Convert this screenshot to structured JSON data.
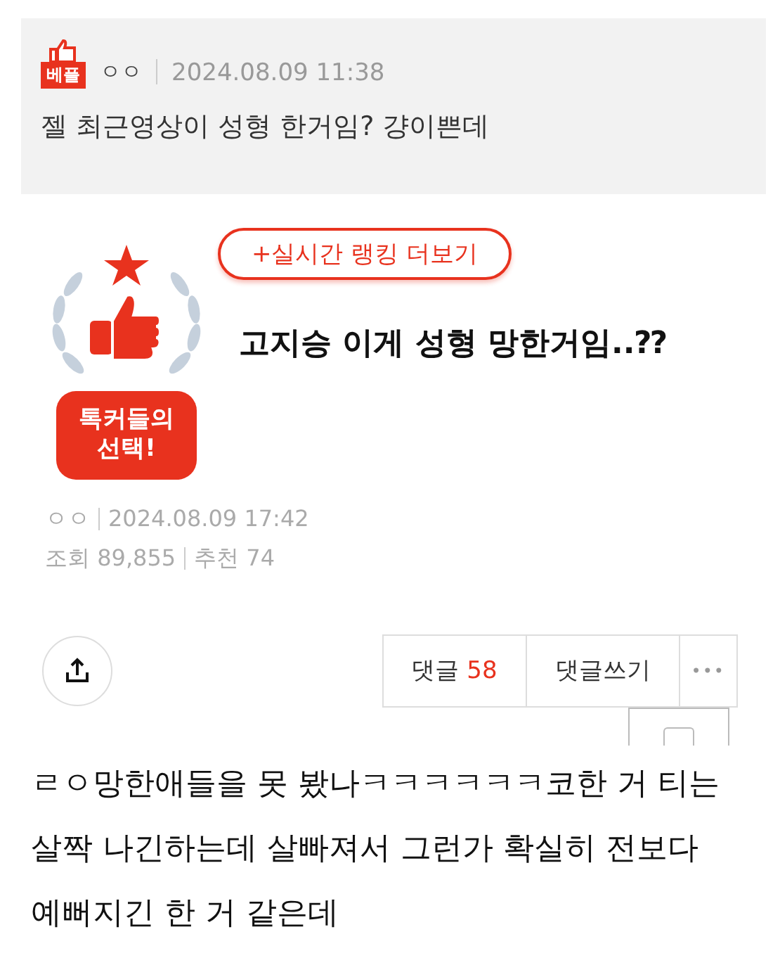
{
  "best_comment": {
    "badge": "베플",
    "author": "ㅇㅇ",
    "date": "2024.08.09 11:38",
    "text": "젤 최근영상이 성형 한거임? 걍이쁜데"
  },
  "ranking_button": "+실시간 랭킹 더보기",
  "emblem": {
    "label": "톡커들의\n선택!"
  },
  "post": {
    "title": "고지승 이게 성형 망한거임..⁇",
    "author": "ㅇㅇ",
    "date": "2024.08.09 17:42",
    "views_label": "조회",
    "views": "89,855",
    "likes_label": "추천",
    "likes": "74"
  },
  "actions": {
    "comments_label": "댓글",
    "comments_count": "58",
    "write_label": "댓글쓰기",
    "more": "•••"
  },
  "body": "ㄹㅇ망한애들을 못 봤나ㅋㅋㅋㅋㅋㅋ코한 거 티는 살짝 나긴하는데 살빠져서 그런가 확실히 전보다 예뻐지긴 한 거 같은데"
}
